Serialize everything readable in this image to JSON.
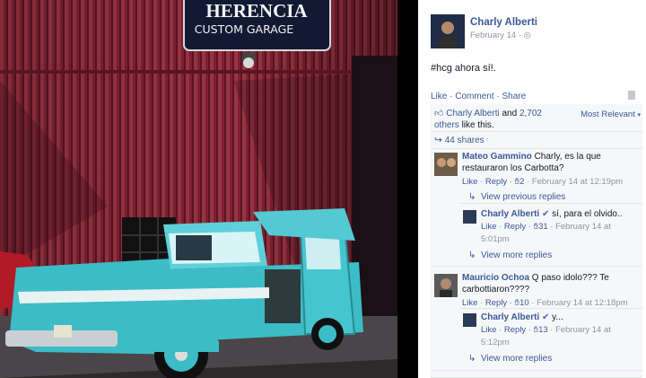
{
  "photo": {
    "sign_line1": "HERENCIA",
    "sign_line2": "CUSTOM GARAGE"
  },
  "post": {
    "author": "Charly Alberti",
    "date": "February 14 · ",
    "text": "#hcg ahora sí!.",
    "actions": {
      "like": "Like",
      "sep1": " · ",
      "comment": "Comment",
      "sep2": " · ",
      "share": "Share"
    }
  },
  "likes": {
    "name": "Charly Alberti",
    "and": " and ",
    "others": "2,702 others",
    "suffix": " like this.",
    "sort": "Most Relevant"
  },
  "shares": {
    "label": "44 shares"
  },
  "comments": [
    {
      "name": "Mateo Gammino",
      "text": " Charly, es la que restauraron los Carbotta?",
      "like": "Like",
      "reply": "Reply",
      "likes": "2",
      "time": "February 14 at 12:19pm"
    },
    {
      "name": "Mauricio Ochoa",
      "text": " Q paso idolo??? Te carbottiaron????",
      "like": "Like",
      "reply": "Reply",
      "likes": "10",
      "time": "February 14 at 12:18pm"
    }
  ],
  "replies": [
    {
      "name": "Charly Alberti",
      "text": " sí, para el olvido..",
      "like": "Like",
      "reply": "Reply",
      "likes": "31",
      "time": "February 14 at 5:01pm"
    },
    {
      "name": "Charly Alberti",
      "text": " y...",
      "like": "Like",
      "reply": "Reply",
      "likes": "13",
      "time": "February 14 at 5:12pm"
    }
  ],
  "links": {
    "view_previous": "View previous replies",
    "view_more_1": "View more replies",
    "view_more_2": "View more replies"
  },
  "colors": {
    "link": "#3b5998",
    "muted": "#90949c",
    "verified": "#4267b2",
    "truck": "#3cbcc6",
    "wall": "#7a1e2c"
  }
}
